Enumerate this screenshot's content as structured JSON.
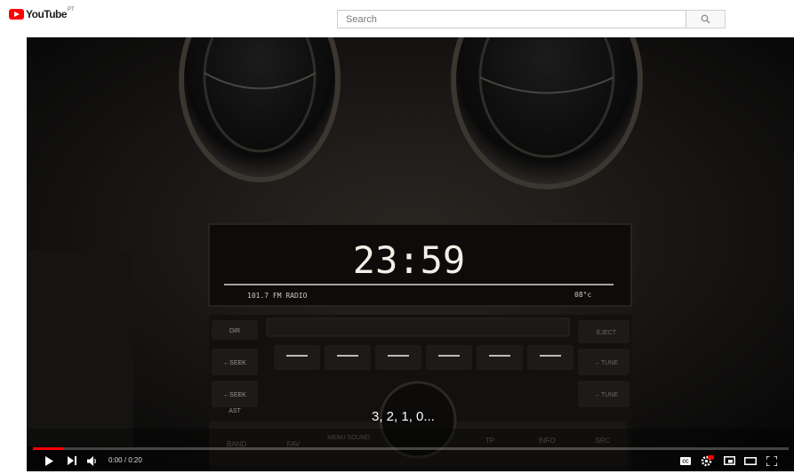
{
  "header": {
    "logo_text": "YouTube",
    "country_code": "PT",
    "search_placeholder": "Search"
  },
  "video": {
    "caption": "3, 2, 1, 0...",
    "time_display": "0:00 / 0:20",
    "progress_fraction": 0.04,
    "radio": {
      "clock": "23:59",
      "station": "101.7 FM  RADIO",
      "temp": "08°c",
      "buttons_left": [
        "DIR",
        "←SEEK",
        "←SEEK",
        "AST"
      ],
      "buttons_right": [
        "EJECT",
        "←TUNE",
        "←TUNE"
      ],
      "buttons_bottom": [
        "BAND",
        "FAV",
        "MENU SOUND",
        "TP",
        "INFO",
        "SRC"
      ]
    }
  },
  "colors": {
    "brand_red": "#ff0000",
    "progress_red": "#ff0000",
    "clock_color": "#f4efe6"
  },
  "icons": [
    "search-icon",
    "play-icon",
    "next-icon",
    "volume-icon",
    "subtitles-icon",
    "settings-icon",
    "miniplayer-icon",
    "theater-icon",
    "fullscreen-icon"
  ]
}
